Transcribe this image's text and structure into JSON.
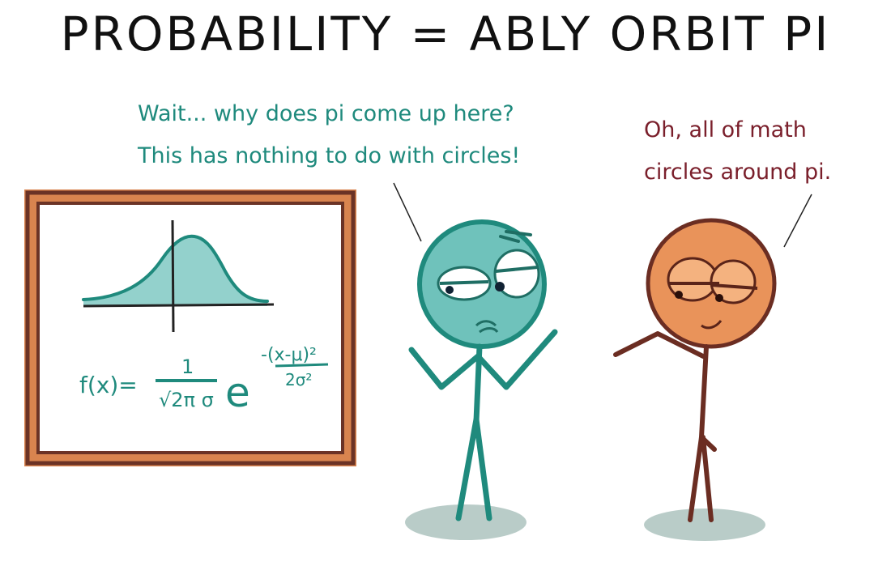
{
  "title": "PROBABILITY = ABLY ORBIT PI",
  "speech_left": {
    "lines": [
      "Wait... why does pi come up here?",
      "This has nothing to do with circles!"
    ]
  },
  "speech_right": {
    "lines": [
      "Oh, all of math",
      "circles around pi."
    ]
  },
  "board": {
    "formula_lhs": "f(x)=",
    "numerator": "1",
    "denominator": "√2π σ",
    "base": "e",
    "exponent_top": "-(x-μ)²",
    "exponent_bottom": "2σ²"
  },
  "colors": {
    "teal": "#1f8a7d",
    "teal_fill": "#6fc2bb",
    "maroon": "#7a1f2b",
    "orange": "#e9935a",
    "frame_brown": "#6b3326",
    "frame_orange": "#d9844f",
    "ink": "#111111",
    "ground": "#7fa39a"
  }
}
